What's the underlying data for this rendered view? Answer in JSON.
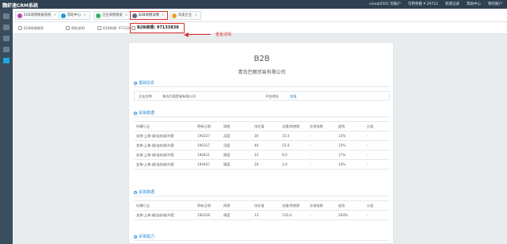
{
  "app": {
    "title": "魏虾速CRM系统",
    "user": "xiaoqi0501 的账户",
    "balance_label": "可用余额",
    "balance": "¥ 29712",
    "menu": [
      "新建记录",
      "帮助中心",
      "我的账户"
    ]
  },
  "tabs_top": [
    {
      "label": "B2B商情数据系统",
      "active": false,
      "icon_color": "#c93fb1"
    },
    {
      "label": "帮助中心",
      "active": false,
      "icon_color": "#1a9bd7"
    },
    {
      "label": "企业商情搜索",
      "active": false,
      "icon_color": "#2fb26a"
    },
    {
      "label": "B2B商情详情",
      "active": true,
      "icon_color": "#5b6c7c"
    },
    {
      "label": "同类企业",
      "active": false,
      "icon_color": "#e8a228"
    }
  ],
  "tabs_sub": [
    {
      "label": "B2B商情搜索",
      "active": false
    },
    {
      "label": "帮助说明",
      "active": false
    },
    {
      "label": "B2B商情: 97133838",
      "active": false
    },
    {
      "label": "B2B商情: 97133838",
      "active": true
    }
  ],
  "annotation": {
    "text": "查看详情"
  },
  "doc": {
    "title": "B2B",
    "company": "青岛巴图贸易有限公司",
    "basic_section": "基础信息",
    "fields": {
      "company_label": "企业名称",
      "company_value": "青岛巴图贸易有限公司",
      "platform_label": "平台地址",
      "platform_link": "查看"
    },
    "section1": "贸易数据",
    "section2": "贸易数据",
    "section3": "贸易能力",
    "columns": [
      "所属行业",
      "更新日期",
      "周期",
      "排名值",
      "流量/销售数",
      "交易指数",
      "趋势",
      "分类"
    ],
    "rows1": [
      [
        "女装-上装-裙/连衣裙/外套",
        "190227",
        "月度",
        "30",
        "15.0",
        "-",
        "13%",
        "-"
      ],
      [
        "女装-上装-裙/连衣裙/外套",
        "190317",
        "月度",
        "46",
        "15.0",
        "-",
        "15%",
        "-"
      ],
      [
        "女装-上装-裙/连衣裙/外套",
        "190421",
        "周度",
        "23",
        "8.0",
        "-",
        "17%",
        "-"
      ],
      [
        "女装-上装-裙/连衣裙/外套",
        "190407",
        "周度",
        "26",
        "3.0",
        "-",
        "14%",
        "-"
      ]
    ],
    "rows2": [
      [
        "女装-上装-裙/连衣裙/外套",
        "190328",
        "周度",
        "13",
        "116.0",
        "-",
        "204%",
        "-"
      ]
    ]
  }
}
